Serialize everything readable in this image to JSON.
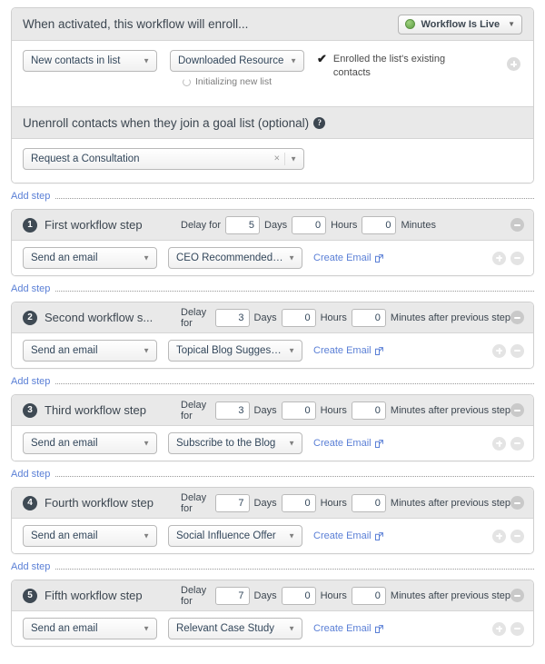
{
  "enrollment": {
    "header_title": "When activated, this workflow will enroll...",
    "status_button": {
      "label": "Workflow Is Live",
      "dot_color": "#6aa84f",
      "caret_icon": "chevron-down-icon"
    },
    "trigger_type": {
      "value": "New contacts in list",
      "caret_icon": "chevron-down-icon"
    },
    "trigger_list": {
      "value": "Downloaded Resource",
      "caret_icon": "chevron-down-icon"
    },
    "initializing": {
      "icon": "spinner-icon",
      "text": "Initializing new list"
    },
    "enrolled_note": {
      "icon": "check-icon",
      "text": "Enrolled the list's existing contacts"
    },
    "add_trigger_icon": "plus-circle-icon"
  },
  "unenroll": {
    "header_title": "Unenroll contacts when they join a goal list (optional)",
    "help_icon": "help-circle-icon",
    "help_glyph": "?",
    "goal_list": {
      "value": "Request a Consultation",
      "clear_icon": "close-icon",
      "clear_glyph": "×",
      "caret_icon": "chevron-down-icon"
    }
  },
  "add_step": {
    "label": "Add step"
  },
  "labels": {
    "delay_for": "Delay for",
    "days": "Days",
    "hours": "Hours",
    "minutes": "Minutes",
    "minutes_after": "Minutes after previous step",
    "create_email": "Create Email",
    "external_link_icon": "external-link-icon",
    "remove_icon": "minus-circle-icon",
    "add_icon": "plus-circle-icon"
  },
  "steps": [
    {
      "number": "1",
      "title": "First workflow step",
      "delay_days": "5",
      "delay_hours": "0",
      "delay_minutes": "0",
      "minutes_label": "Minutes",
      "action": "Send an email",
      "email": "CEO Recommended ...",
      "create_email": "Create Email"
    },
    {
      "number": "2",
      "title": "Second workflow s...",
      "delay_days": "3",
      "delay_hours": "0",
      "delay_minutes": "0",
      "minutes_label": "Minutes after previous step",
      "action": "Send an email",
      "email": "Topical Blog Suggestion",
      "create_email": "Create Email"
    },
    {
      "number": "3",
      "title": "Third workflow step",
      "delay_days": "3",
      "delay_hours": "0",
      "delay_minutes": "0",
      "minutes_label": "Minutes after previous step",
      "action": "Send an email",
      "email": "Subscribe to the Blog",
      "create_email": "Create Email"
    },
    {
      "number": "4",
      "title": "Fourth workflow step",
      "delay_days": "7",
      "delay_hours": "0",
      "delay_minutes": "0",
      "minutes_label": "Minutes after previous step",
      "action": "Send an email",
      "email": "Social Influence Offer",
      "create_email": "Create Email"
    },
    {
      "number": "5",
      "title": "Fifth workflow step",
      "delay_days": "7",
      "delay_hours": "0",
      "delay_minutes": "0",
      "minutes_label": "Minutes after previous step",
      "action": "Send an email",
      "email": "Relevant Case Study",
      "create_email": "Create Email"
    }
  ],
  "colors": {
    "link": "#5a7fd6",
    "header_bg": "#e9e9e9",
    "badge_bg": "#3f4a54",
    "live_green": "#6aa84f"
  }
}
